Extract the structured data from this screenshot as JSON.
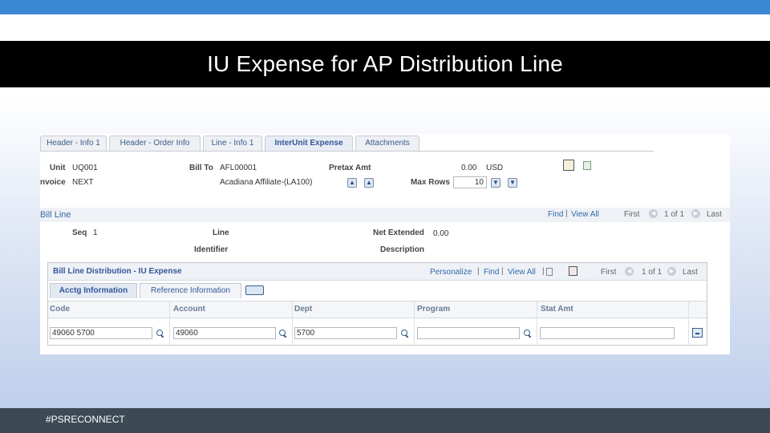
{
  "slide": {
    "title": "IU Expense for AP Distribution  Line",
    "footer": "#PSRECONNECT"
  },
  "tabs": [
    {
      "label": "Header - Info 1"
    },
    {
      "label": "Header - Order Info"
    },
    {
      "label": "Line - Info 1"
    },
    {
      "label": "InterUnit Expense"
    },
    {
      "label": "Attachments"
    }
  ],
  "header": {
    "unit_label": "Unit",
    "unit_value": "UQ001",
    "invoice_label": "nvoice",
    "invoice_value": "NEXT",
    "bill_to_label": "Bill To",
    "bill_to_value": "AFL00001",
    "bill_to_desc": "Acadiana Affiliate-(LA100)",
    "pretax_label": "Pretax Amt",
    "pretax_value": "0.00",
    "currency": "USD",
    "max_rows_label": "Max Rows",
    "max_rows_value": "10"
  },
  "bill_line": {
    "title": "Bill Line",
    "find": "Find",
    "view_all": "View All",
    "first": "First",
    "counter": "1 of 1",
    "last": "Last",
    "seq_label": "Seq",
    "seq_value": "1",
    "line_label": "Line",
    "identifier_label": "Identifier",
    "net_extended_label": "Net Extended",
    "net_extended_value": "0.00",
    "description_label": "Description"
  },
  "distribution": {
    "title": "Bill Line Distribution - IU Expense",
    "personalize": "Personalize",
    "find": "Find",
    "view_all": "View All",
    "first": "First",
    "counter": "1 of 1",
    "last": "Last",
    "subtabs": [
      {
        "label": "Acctg Information"
      },
      {
        "label": "Reference Information"
      }
    ],
    "columns": [
      "Code",
      "Account",
      "Dept",
      "Program",
      "Stat Amt"
    ],
    "row": {
      "code": "49060 5700",
      "account": "49060",
      "dept": "5700",
      "program": "",
      "stat_amt": ""
    }
  },
  "icons": {
    "bill_to_prev": "up-arrow-icon",
    "bill_to_next": "up-arrow-icon",
    "max_rows_down": "down-arrow-icon",
    "max_rows_last": "down-arrow-icon",
    "book": "book-icon",
    "sheet": "spreadsheet-icon",
    "grid": "grid-icon",
    "expand_tabs": "show-all-columns-icon",
    "delete_row": "delete-row-icon"
  },
  "colors": {
    "top_bar": "#3a87d4",
    "title_bar": "#000000",
    "footer_bar": "#3c4a54",
    "link": "#3469a6"
  }
}
